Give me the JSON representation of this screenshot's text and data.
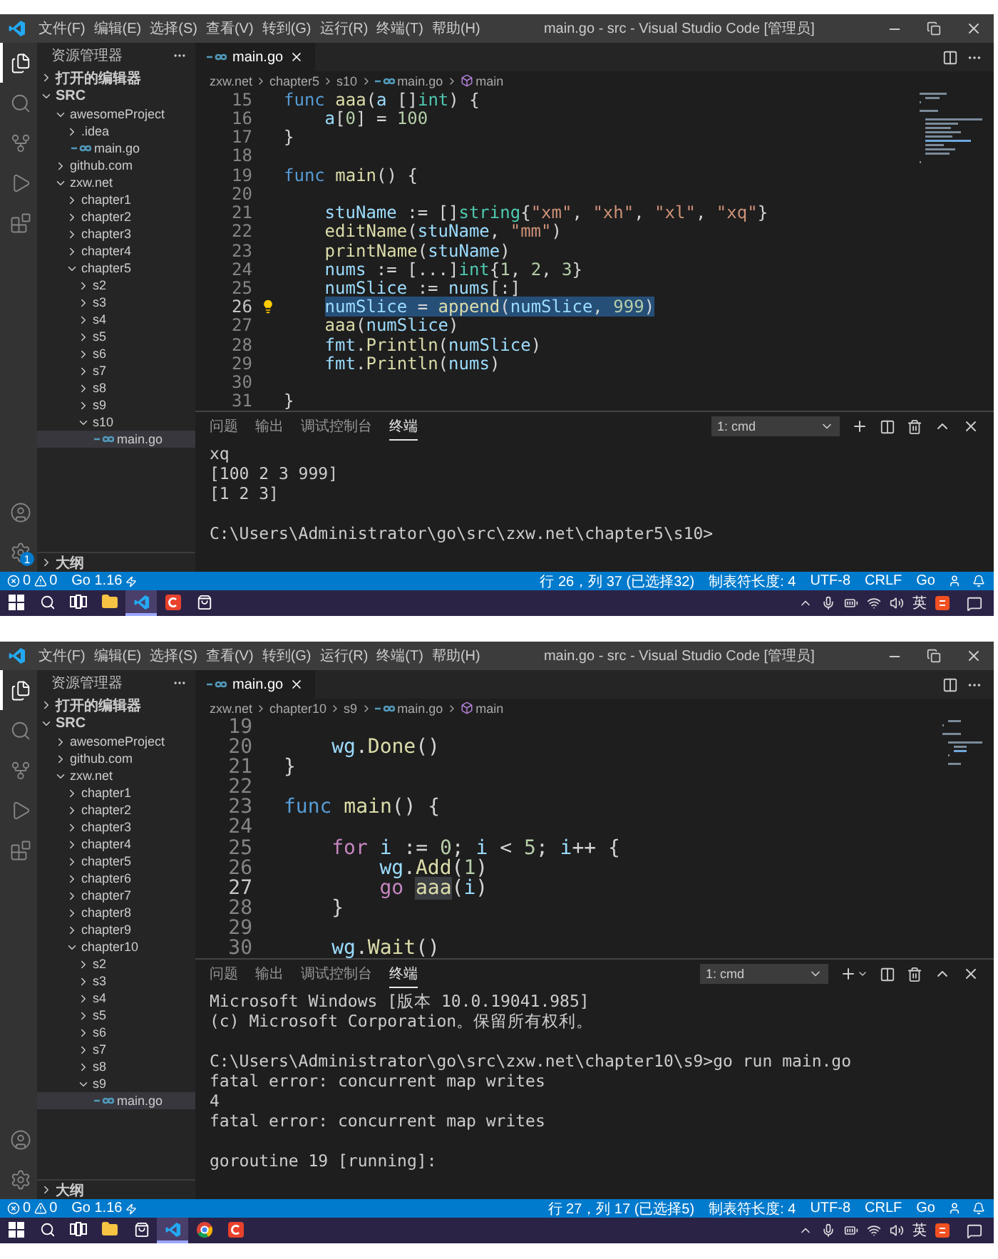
{
  "screens": [
    {
      "window": {
        "title": "main.go - src - Visual Studio Code [管理员]"
      },
      "menu": [
        "文件(F)",
        "编辑(E)",
        "选择(S)",
        "查看(V)",
        "转到(G)",
        "运行(R)",
        "终端(T)",
        "帮助(H)"
      ],
      "activity_bar": [
        {
          "kind": "explorer",
          "selected": true
        },
        {
          "kind": "search",
          "selected": false
        },
        {
          "kind": "source-control",
          "selected": false
        },
        {
          "kind": "run",
          "selected": false
        },
        {
          "kind": "extensions",
          "selected": false
        }
      ],
      "activity_bottom": [
        {
          "kind": "account"
        },
        {
          "kind": "settings",
          "badge": "1"
        }
      ],
      "sidebar": {
        "title": "资源管理器",
        "open_editors": {
          "label": "打开的编辑器",
          "expanded": false
        },
        "root": {
          "label": "SRC",
          "expanded": true
        },
        "tree": [
          {
            "label": "awesomeProject",
            "kind": "folder",
            "expanded": true,
            "selected": false,
            "children": [
              {
                "label": ".idea",
                "kind": "folder",
                "expanded": false,
                "selected": false
              },
              {
                "label": "main.go",
                "kind": "file",
                "selected": false
              }
            ]
          },
          {
            "label": "github.com",
            "kind": "folder",
            "expanded": false,
            "selected": false
          },
          {
            "label": "zxw.net",
            "kind": "folder",
            "expanded": true,
            "selected": false,
            "children": [
              {
                "label": "chapter1",
                "kind": "folder",
                "expanded": false,
                "selected": false
              },
              {
                "label": "chapter2",
                "kind": "folder",
                "expanded": false,
                "selected": false
              },
              {
                "label": "chapter3",
                "kind": "folder",
                "expanded": false,
                "selected": false
              },
              {
                "label": "chapter4",
                "kind": "folder",
                "expanded": false,
                "selected": false
              },
              {
                "label": "chapter5",
                "kind": "folder",
                "expanded": true,
                "selected": false,
                "children": [
                  {
                    "label": "s2",
                    "kind": "folder",
                    "expanded": false,
                    "selected": false
                  },
                  {
                    "label": "s3",
                    "kind": "folder",
                    "expanded": false,
                    "selected": false
                  },
                  {
                    "label": "s4",
                    "kind": "folder",
                    "expanded": false,
                    "selected": false
                  },
                  {
                    "label": "s5",
                    "kind": "folder",
                    "expanded": false,
                    "selected": false
                  },
                  {
                    "label": "s6",
                    "kind": "folder",
                    "expanded": false,
                    "selected": false
                  },
                  {
                    "label": "s7",
                    "kind": "folder",
                    "expanded": false,
                    "selected": false
                  },
                  {
                    "label": "s8",
                    "kind": "folder",
                    "expanded": false,
                    "selected": false
                  },
                  {
                    "label": "s9",
                    "kind": "folder",
                    "expanded": false,
                    "selected": false
                  },
                  {
                    "label": "s10",
                    "kind": "folder",
                    "expanded": true,
                    "selected": false,
                    "children": [
                      {
                        "label": "main.go",
                        "kind": "file",
                        "selected": true
                      }
                    ]
                  }
                ]
              }
            ]
          }
        ],
        "outline": {
          "label": "大纲",
          "expanded": false
        }
      },
      "editor": {
        "tab": {
          "label": "main.go",
          "selected": true
        },
        "breadcrumbs": [
          {
            "label": "zxw.net",
            "kind": "folder"
          },
          {
            "label": "chapter5",
            "kind": "folder"
          },
          {
            "label": "s10",
            "kind": "folder"
          },
          {
            "label": "main.go",
            "kind": "file"
          },
          {
            "label": "main",
            "kind": "symbol"
          }
        ],
        "lines": [
          {
            "number": "15",
            "current": false,
            "kind": "flush",
            "tokens": [
              {
                "text": "func ",
                "kind": "keyword"
              },
              {
                "text": "aaa",
                "kind": "function"
              },
              {
                "text": "(",
                "kind": "plain"
              },
              {
                "text": "a",
                "kind": "variable"
              },
              {
                "text": " []",
                "kind": "plain"
              },
              {
                "text": "int",
                "kind": "type"
              },
              {
                "text": ") {",
                "kind": "plain"
              }
            ]
          },
          {
            "number": "16",
            "current": false,
            "kind": "indented",
            "tokens": [
              {
                "text": "a",
                "kind": "variable"
              },
              {
                "text": "[",
                "kind": "plain"
              },
              {
                "text": "0",
                "kind": "number"
              },
              {
                "text": "] = ",
                "kind": "plain"
              },
              {
                "text": "100",
                "kind": "number"
              }
            ]
          },
          {
            "number": "17",
            "current": false,
            "kind": "flush",
            "tokens": [
              {
                "text": "}",
                "kind": "plain"
              }
            ]
          },
          {
            "number": "18",
            "current": false
          },
          {
            "number": "19",
            "current": false,
            "kind": "flush",
            "tokens": [
              {
                "text": "func ",
                "kind": "keyword"
              },
              {
                "text": "main",
                "kind": "function"
              },
              {
                "text": "() {",
                "kind": "plain"
              }
            ]
          },
          {
            "number": "20",
            "current": false
          },
          {
            "number": "21",
            "current": false,
            "kind": "indented",
            "tokens": [
              {
                "text": "stuName",
                "kind": "variable"
              },
              {
                "text": " := []",
                "kind": "plain"
              },
              {
                "text": "string",
                "kind": "type"
              },
              {
                "text": "{",
                "kind": "plain"
              },
              {
                "text": "\"xm\"",
                "kind": "string"
              },
              {
                "text": ", ",
                "kind": "plain"
              },
              {
                "text": "\"xh\"",
                "kind": "string"
              },
              {
                "text": ", ",
                "kind": "plain"
              },
              {
                "text": "\"xl\"",
                "kind": "string"
              },
              {
                "text": ", ",
                "kind": "plain"
              },
              {
                "text": "\"xq\"",
                "kind": "string"
              },
              {
                "text": "}",
                "kind": "plain"
              }
            ]
          },
          {
            "number": "22",
            "current": false,
            "kind": "indented",
            "tokens": [
              {
                "text": "editName",
                "kind": "function"
              },
              {
                "text": "(",
                "kind": "plain"
              },
              {
                "text": "stuName",
                "kind": "variable"
              },
              {
                "text": ", ",
                "kind": "plain"
              },
              {
                "text": "\"mm\"",
                "kind": "string"
              },
              {
                "text": ")",
                "kind": "plain"
              }
            ]
          },
          {
            "number": "23",
            "current": false,
            "kind": "indented",
            "tokens": [
              {
                "text": "printName",
                "kind": "function"
              },
              {
                "text": "(",
                "kind": "plain"
              },
              {
                "text": "stuName",
                "kind": "variable"
              },
              {
                "text": ")",
                "kind": "plain"
              }
            ]
          },
          {
            "number": "24",
            "current": false,
            "kind": "indented",
            "tokens": [
              {
                "text": "nums",
                "kind": "variable"
              },
              {
                "text": " := [...]",
                "kind": "plain"
              },
              {
                "text": "int",
                "kind": "type"
              },
              {
                "text": "{",
                "kind": "plain"
              },
              {
                "text": "1",
                "kind": "number"
              },
              {
                "text": ", ",
                "kind": "plain"
              },
              {
                "text": "2",
                "kind": "number"
              },
              {
                "text": ", ",
                "kind": "plain"
              },
              {
                "text": "3",
                "kind": "number"
              },
              {
                "text": "}",
                "kind": "plain"
              }
            ]
          },
          {
            "number": "25",
            "current": false,
            "kind": "indented",
            "tokens": [
              {
                "text": "numSlice",
                "kind": "variable"
              },
              {
                "text": " := ",
                "kind": "plain"
              },
              {
                "text": "nums",
                "kind": "variable"
              },
              {
                "text": "[:]",
                "kind": "plain"
              }
            ]
          },
          {
            "number": "26",
            "current": true,
            "selected": true,
            "lightbulb": true,
            "kind": "indented",
            "tokens": [
              {
                "text": "numSlice",
                "kind": "variable"
              },
              {
                "text": " = ",
                "kind": "plain"
              },
              {
                "text": "append",
                "kind": "function"
              },
              {
                "text": "(",
                "kind": "plain"
              },
              {
                "text": "numSlice",
                "kind": "variable"
              },
              {
                "text": ", ",
                "kind": "plain"
              },
              {
                "text": "999",
                "kind": "number"
              },
              {
                "text": ")",
                "kind": "plain"
              }
            ]
          },
          {
            "number": "27",
            "current": false,
            "kind": "indented",
            "tokens": [
              {
                "text": "aaa",
                "kind": "function"
              },
              {
                "text": "(",
                "kind": "plain"
              },
              {
                "text": "numSlice",
                "kind": "variable"
              },
              {
                "text": ")",
                "kind": "plain"
              }
            ]
          },
          {
            "number": "28",
            "current": false,
            "kind": "indented",
            "tokens": [
              {
                "text": "fmt",
                "kind": "variable"
              },
              {
                "text": ".",
                "kind": "plain"
              },
              {
                "text": "Println",
                "kind": "function"
              },
              {
                "text": "(",
                "kind": "plain"
              },
              {
                "text": "numSlice",
                "kind": "variable"
              },
              {
                "text": ")",
                "kind": "plain"
              }
            ]
          },
          {
            "number": "29",
            "current": false,
            "kind": "indented",
            "tokens": [
              {
                "text": "fmt",
                "kind": "variable"
              },
              {
                "text": ".",
                "kind": "plain"
              },
              {
                "text": "Println",
                "kind": "function"
              },
              {
                "text": "(",
                "kind": "plain"
              },
              {
                "text": "nums",
                "kind": "variable"
              },
              {
                "text": ")",
                "kind": "plain"
              }
            ]
          },
          {
            "number": "30",
            "current": false
          },
          {
            "number": "31",
            "current": false,
            "kind": "flush",
            "tokens": [
              {
                "text": "}",
                "kind": "plain"
              }
            ]
          }
        ]
      },
      "panel": {
        "tabs": [
          {
            "label": "问题",
            "selected": false
          },
          {
            "label": "输出",
            "selected": false
          },
          {
            "label": "调试控制台",
            "selected": false
          },
          {
            "label": "终端",
            "selected": true
          }
        ],
        "terminal_select": "1: cmd",
        "plus_menu": false,
        "blocks": [
          [
            "xq",
            "[100 2 3 999]",
            "[1 2 3]"
          ],
          [
            "C:\\Users\\Administrator\\go\\src\\zxw.net\\chapter5\\s10>"
          ]
        ]
      },
      "status_bar": {
        "errors": "0",
        "warnings": "0",
        "go_version": "Go 1.16",
        "right": [
          "行 26，列 37 (已选择32)",
          "制表符长度: 4",
          "UTF-8",
          "CRLF",
          "Go"
        ]
      },
      "taskbar": {
        "apps": [
          {
            "kind": "start",
            "active": false
          },
          {
            "kind": "search",
            "active": false
          },
          {
            "kind": "task-view",
            "active": false
          },
          {
            "kind": "explorer",
            "active": false
          },
          {
            "kind": "vscode",
            "active": true
          },
          {
            "kind": "c-app",
            "active": false
          },
          {
            "kind": "store",
            "active": false
          }
        ],
        "ime": "英"
      }
    },
    {
      "window": {
        "title": "main.go - src - Visual Studio Code [管理员]"
      },
      "menu": [
        "文件(F)",
        "编辑(E)",
        "选择(S)",
        "查看(V)",
        "转到(G)",
        "运行(R)",
        "终端(T)",
        "帮助(H)"
      ],
      "activity_bar": [
        {
          "kind": "explorer",
          "selected": true
        },
        {
          "kind": "search",
          "selected": false
        },
        {
          "kind": "source-control",
          "selected": false
        },
        {
          "kind": "run",
          "selected": false
        },
        {
          "kind": "extensions",
          "selected": false
        }
      ],
      "activity_bottom": [
        {
          "kind": "account"
        },
        {
          "kind": "settings"
        }
      ],
      "sidebar": {
        "title": "资源管理器",
        "open_editors": {
          "label": "打开的编辑器",
          "expanded": false
        },
        "root": {
          "label": "SRC",
          "expanded": true
        },
        "tree": [
          {
            "label": "awesomeProject",
            "kind": "folder",
            "expanded": false,
            "selected": false
          },
          {
            "label": "github.com",
            "kind": "folder",
            "expanded": false,
            "selected": false
          },
          {
            "label": "zxw.net",
            "kind": "folder",
            "expanded": true,
            "selected": false,
            "children": [
              {
                "label": "chapter1",
                "kind": "folder",
                "expanded": false,
                "selected": false
              },
              {
                "label": "chapter2",
                "kind": "folder",
                "expanded": false,
                "selected": false
              },
              {
                "label": "chapter3",
                "kind": "folder",
                "expanded": false,
                "selected": false
              },
              {
                "label": "chapter4",
                "kind": "folder",
                "expanded": false,
                "selected": false
              },
              {
                "label": "chapter5",
                "kind": "folder",
                "expanded": false,
                "selected": false
              },
              {
                "label": "chapter6",
                "kind": "folder",
                "expanded": false,
                "selected": false
              },
              {
                "label": "chapter7",
                "kind": "folder",
                "expanded": false,
                "selected": false
              },
              {
                "label": "chapter8",
                "kind": "folder",
                "expanded": false,
                "selected": false
              },
              {
                "label": "chapter9",
                "kind": "folder",
                "expanded": false,
                "selected": false
              },
              {
                "label": "chapter10",
                "kind": "folder",
                "expanded": true,
                "selected": false,
                "children": [
                  {
                    "label": "s2",
                    "kind": "folder",
                    "expanded": false,
                    "selected": false
                  },
                  {
                    "label": "s3",
                    "kind": "folder",
                    "expanded": false,
                    "selected": false
                  },
                  {
                    "label": "s4",
                    "kind": "folder",
                    "expanded": false,
                    "selected": false
                  },
                  {
                    "label": "s5",
                    "kind": "folder",
                    "expanded": false,
                    "selected": false
                  },
                  {
                    "label": "s6",
                    "kind": "folder",
                    "expanded": false,
                    "selected": false
                  },
                  {
                    "label": "s7",
                    "kind": "folder",
                    "expanded": false,
                    "selected": false
                  },
                  {
                    "label": "s8",
                    "kind": "folder",
                    "expanded": false,
                    "selected": false
                  },
                  {
                    "label": "s9",
                    "kind": "folder",
                    "expanded": true,
                    "selected": false,
                    "children": [
                      {
                        "label": "main.go",
                        "kind": "file",
                        "selected": true
                      }
                    ]
                  }
                ]
              }
            ]
          }
        ],
        "outline": {
          "label": "大纲",
          "expanded": false
        }
      },
      "editor": {
        "tab": {
          "label": "main.go",
          "selected": true
        },
        "breadcrumbs": [
          {
            "label": "zxw.net",
            "kind": "folder"
          },
          {
            "label": "chapter10",
            "kind": "folder"
          },
          {
            "label": "s9",
            "kind": "folder"
          },
          {
            "label": "main.go",
            "kind": "file"
          },
          {
            "label": "main",
            "kind": "symbol"
          }
        ],
        "lines": [
          {
            "number": "19",
            "current": false
          },
          {
            "number": "20",
            "current": false,
            "kind": "indented",
            "tokens": [
              {
                "text": "wg",
                "kind": "variable"
              },
              {
                "text": ".",
                "kind": "plain"
              },
              {
                "text": "Done",
                "kind": "function"
              },
              {
                "text": "()",
                "kind": "plain"
              }
            ]
          },
          {
            "number": "21",
            "current": false,
            "kind": "flush",
            "tokens": [
              {
                "text": "}",
                "kind": "plain"
              }
            ]
          },
          {
            "number": "22",
            "current": false
          },
          {
            "number": "23",
            "current": false,
            "kind": "flush",
            "tokens": [
              {
                "text": "func ",
                "kind": "keyword"
              },
              {
                "text": "main",
                "kind": "function"
              },
              {
                "text": "() {",
                "kind": "plain"
              }
            ]
          },
          {
            "number": "24",
            "current": false
          },
          {
            "number": "25",
            "current": false,
            "kind": "indented",
            "tokens": [
              {
                "text": "for ",
                "kind": "control"
              },
              {
                "text": "i",
                "kind": "variable"
              },
              {
                "text": " := ",
                "kind": "plain"
              },
              {
                "text": "0",
                "kind": "number"
              },
              {
                "text": "; ",
                "kind": "plain"
              },
              {
                "text": "i",
                "kind": "variable"
              },
              {
                "text": " < ",
                "kind": "plain"
              },
              {
                "text": "5",
                "kind": "number"
              },
              {
                "text": "; ",
                "kind": "plain"
              },
              {
                "text": "i",
                "kind": "variable"
              },
              {
                "text": "++ {",
                "kind": "plain"
              }
            ]
          },
          {
            "number": "26",
            "current": false,
            "kind": "nested",
            "tokens": [
              {
                "text": "wg",
                "kind": "variable"
              },
              {
                "text": ".",
                "kind": "plain"
              },
              {
                "text": "Add",
                "kind": "function"
              },
              {
                "text": "(",
                "kind": "plain"
              },
              {
                "text": "1",
                "kind": "number"
              },
              {
                "text": ")",
                "kind": "plain"
              }
            ]
          },
          {
            "number": "27",
            "current": true,
            "kind": "nested",
            "tokens": [
              {
                "text": "go ",
                "kind": "control"
              },
              {
                "text": "aaa",
                "kind": "function",
                "highlight": true
              },
              {
                "text": "(",
                "kind": "plain"
              },
              {
                "text": "i",
                "kind": "variable"
              },
              {
                "text": ")",
                "kind": "plain"
              }
            ]
          },
          {
            "number": "28",
            "current": false,
            "kind": "indented",
            "tokens": [
              {
                "text": "}",
                "kind": "plain"
              }
            ]
          },
          {
            "number": "29",
            "current": false
          },
          {
            "number": "30",
            "current": false,
            "kind": "indented",
            "tokens": [
              {
                "text": "wg",
                "kind": "variable"
              },
              {
                "text": ".",
                "kind": "plain"
              },
              {
                "text": "Wait",
                "kind": "function"
              },
              {
                "text": "()",
                "kind": "plain"
              }
            ]
          }
        ]
      },
      "panel": {
        "tabs": [
          {
            "label": "问题",
            "selected": false
          },
          {
            "label": "输出",
            "selected": false
          },
          {
            "label": "调试控制台",
            "selected": false
          },
          {
            "label": "终端",
            "selected": true
          }
        ],
        "terminal_select": "1: cmd",
        "plus_menu": true,
        "blocks": [
          [
            "Microsoft Windows [版本 10.0.19041.985]",
            "(c) Microsoft Corporation。保留所有权利。"
          ],
          [
            "C:\\Users\\Administrator\\go\\src\\zxw.net\\chapter10\\s9>go run main.go",
            "fatal error: concurrent map writes",
            "4",
            "fatal error: concurrent map writes"
          ],
          [
            "goroutine 19 [running]:"
          ]
        ]
      },
      "status_bar": {
        "errors": "0",
        "warnings": "0",
        "go_version": "Go 1.16",
        "right": [
          "行 27，列 17 (已选择5)",
          "制表符长度: 4",
          "UTF-8",
          "CRLF",
          "Go"
        ]
      },
      "taskbar": {
        "apps": [
          {
            "kind": "start",
            "active": false
          },
          {
            "kind": "search",
            "active": false
          },
          {
            "kind": "task-view",
            "active": false
          },
          {
            "kind": "explorer",
            "active": false
          },
          {
            "kind": "store",
            "active": false
          },
          {
            "kind": "vscode",
            "active": true
          },
          {
            "kind": "chrome",
            "active": false
          },
          {
            "kind": "c-app",
            "active": false
          }
        ],
        "ime": "英"
      }
    }
  ]
}
